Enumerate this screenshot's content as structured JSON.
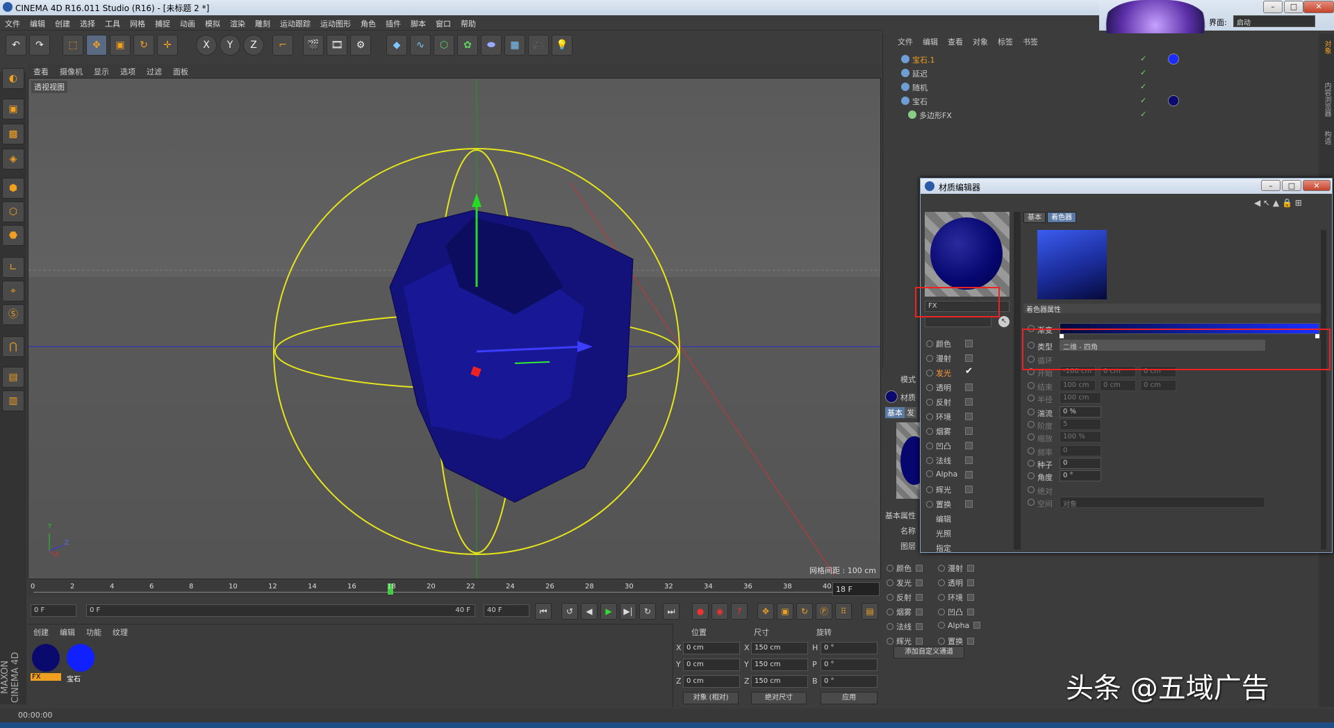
{
  "window": {
    "title": "CINEMA 4D R16.011 Studio (R16) - [未标题 2 *]"
  },
  "interface": {
    "label": "界面:",
    "value": "启动"
  },
  "menu": [
    "文件",
    "编辑",
    "创建",
    "选择",
    "工具",
    "网格",
    "捕捉",
    "动画",
    "模拟",
    "渲染",
    "雕刻",
    "运动跟踪",
    "运动图形",
    "角色",
    "插件",
    "脚本",
    "窗口",
    "帮助"
  ],
  "toolbar": {
    "x": "X",
    "y": "Y",
    "z": "Z"
  },
  "viewport": {
    "menu": [
      "查看",
      "摄像机",
      "显示",
      "选项",
      "过滤",
      "面板"
    ],
    "label": "透视视图",
    "grid": "网格间距 : 100 cm",
    "axis_y": "Y",
    "axis_z": "Z",
    "axis_x": "X"
  },
  "timeline": {
    "ticks": [
      "0",
      "2",
      "4",
      "6",
      "8",
      "10",
      "12",
      "14",
      "16",
      "18",
      "20",
      "22",
      "24",
      "26",
      "28",
      "30",
      "32",
      "34",
      "36",
      "38",
      "40"
    ],
    "current": "18",
    "frame_field": "18 F"
  },
  "transport": {
    "start": "0 F",
    "range_start": "0 F",
    "range_end": "40 F",
    "end": "40 F"
  },
  "matmgr": {
    "menu": [
      "创建",
      "编辑",
      "功能",
      "纹理"
    ],
    "materials": [
      {
        "name": "FX",
        "color": "#0a0a6e"
      },
      {
        "name": "宝石",
        "color": "#1020ff"
      }
    ]
  },
  "coords": {
    "h_pos": "位置",
    "h_size": "尺寸",
    "h_rot": "旋转",
    "px": "0 cm",
    "py": "0 cm",
    "pz": "0 cm",
    "sx": "150 cm",
    "sy": "150 cm",
    "sz": "150 cm",
    "rh": "0 °",
    "rp": "0 °",
    "rb": "0 °",
    "lx": "X",
    "ly": "Y",
    "lz": "Z",
    "lx2": "X",
    "ly2": "Y",
    "lz2": "Z",
    "lh": "H",
    "lp": "P",
    "lb": "B",
    "mode": "对象 (相对)",
    "sizemode": "绝对尺寸",
    "apply": "应用"
  },
  "status": {
    "time": "00:00:00"
  },
  "objmgr": {
    "menu": [
      "文件",
      "编辑",
      "查看",
      "对象",
      "标签",
      "书签"
    ],
    "objects": [
      {
        "name": "宝石.1",
        "tag": "#1a2cff"
      },
      {
        "name": "延迟",
        "tag": ""
      },
      {
        "name": "随机",
        "tag": ""
      },
      {
        "name": "宝石",
        "tag": "#0a0a6e"
      },
      {
        "name": "多边形FX",
        "tag": ""
      }
    ]
  },
  "attr": {
    "mode": "模式",
    "mat_label": "材质",
    "tab_basic": "基本",
    "tab_fx": "发",
    "basic_props": "基本属性",
    "name": "名称",
    "layer": "图层",
    "add_channel": "添加自定义通道",
    "channels_left": [
      "颜色",
      "发光",
      "反射",
      "烟雾",
      "法线",
      "辉光"
    ],
    "channels_right": [
      "漫射",
      "透明",
      "环境",
      "凹凸",
      "Alpha",
      "置换"
    ]
  },
  "mateditor": {
    "title": "材质编辑器",
    "mat_name": "FX",
    "channels": [
      {
        "name": "颜色",
        "on": false
      },
      {
        "name": "漫射",
        "on": false
      },
      {
        "name": "发光",
        "on": true
      },
      {
        "name": "透明",
        "on": false
      },
      {
        "name": "反射",
        "on": false
      },
      {
        "name": "环境",
        "on": false
      },
      {
        "name": "烟雾",
        "on": false
      },
      {
        "name": "凹凸",
        "on": false
      },
      {
        "name": "法线",
        "on": false
      },
      {
        "name": "Alpha",
        "on": false
      },
      {
        "name": "辉光",
        "on": false
      },
      {
        "name": "置换",
        "on": false
      }
    ],
    "extra": [
      "编辑",
      "光照",
      "指定"
    ],
    "tab_basic": "基本",
    "tab_shader": "着色器",
    "shader_props": "着色器属性",
    "gradient": "渐变",
    "type": "类型",
    "type_value": "二维 - 四角",
    "loop": "循环",
    "start": "开始",
    "end": "结束",
    "radius": "半径",
    "turbulence": "湍流",
    "octaves": "阶度",
    "scale": "缩放",
    "frequency": "频率",
    "seed": "种子",
    "angle": "角度",
    "absolute": "绝对",
    "space": "空间",
    "start_vals": [
      "-100 cm",
      "0 cm",
      "0 cm"
    ],
    "end_vals": [
      "100 cm",
      "0 cm",
      "0 cm"
    ],
    "radius_val": "100 cm",
    "turb_val": "0 %",
    "oct_val": "5",
    "scale_val": "100 %",
    "freq_val": "0",
    "seed_val": "0",
    "angle_val": "0 °",
    "space_val": "对象",
    "gradient_colors": [
      "#050a3a",
      "#1a30ff"
    ]
  },
  "watermark": "头条 @五域广告",
  "logo": "MAXON CINEMA 4D"
}
